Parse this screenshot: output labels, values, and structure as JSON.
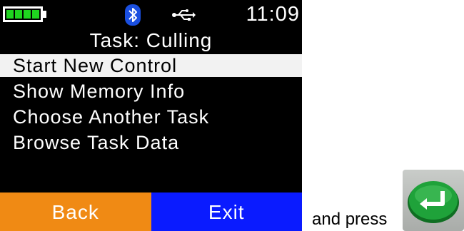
{
  "status": {
    "battery_icon": "battery-full-icon",
    "bluetooth_icon": "bluetooth-icon",
    "usb_icon": "usb-icon",
    "time": "11:09",
    "colors": {
      "battery": "#1fd41f",
      "bluetooth": "#1a4fe0"
    }
  },
  "task": {
    "title": "Task: Culling"
  },
  "menu": {
    "items": [
      {
        "label": "Start New Control",
        "selected": true
      },
      {
        "label": "Show Memory Info"
      },
      {
        "label": "Choose Another Task"
      },
      {
        "label": "Browse Task Data"
      }
    ]
  },
  "softkeys": {
    "left": {
      "label": "Back",
      "color": "#f08a14"
    },
    "right": {
      "label": "Exit",
      "color": "#0a1bff"
    }
  },
  "instruction": {
    "text": "and press",
    "key_icon": "enter-key-icon",
    "key_color": "#1fa23a"
  }
}
